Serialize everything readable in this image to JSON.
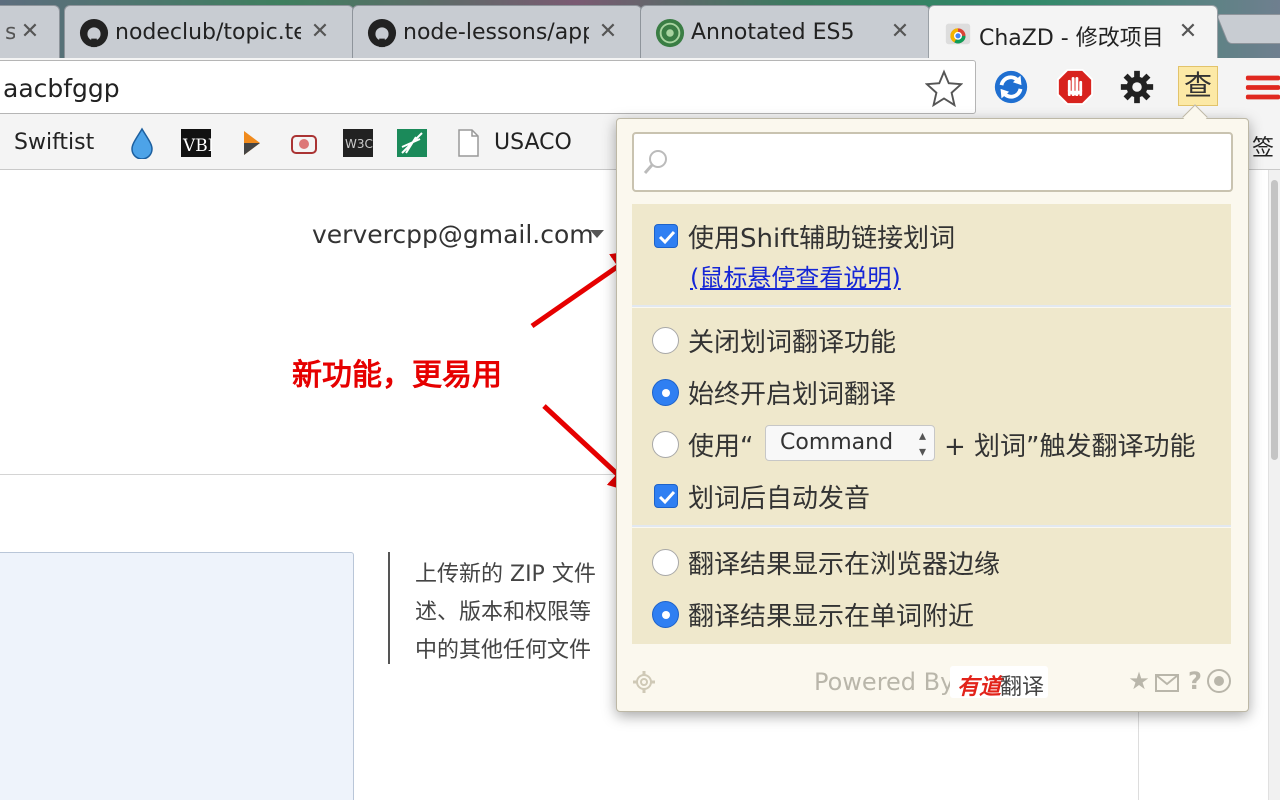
{
  "tabs": [
    {
      "title": "ss",
      "close": "✕"
    },
    {
      "title": "nodeclub/topic.te",
      "close": "✕"
    },
    {
      "title": "node-lessons/app",
      "close": "✕"
    },
    {
      "title": "Annotated ES5",
      "close": "✕"
    },
    {
      "title": "ChaZD - 修改项目",
      "close": "✕"
    }
  ],
  "toolbar": {
    "url": "aacbfggp",
    "extensions": [
      "sync-icon",
      "adblock-icon",
      "gear-icon",
      "chazd-icon",
      "menu-icon"
    ],
    "chazd_label": "查"
  },
  "bookmarks": {
    "swiftist": "Swiftist",
    "usaco": "USACO",
    "overflow": "签"
  },
  "page": {
    "account": "ververcpp@gmail.com",
    "desc_lines": [
      "上传新的 ZIP 文件",
      "述、版本和权限等",
      "中的其他任何文件"
    ]
  },
  "annotation": {
    "text": "新功能，更易用"
  },
  "popup": {
    "search": {
      "value": "",
      "placeholder": ""
    },
    "shift_option": {
      "label": "使用Shift辅助链接划词",
      "checked": true
    },
    "help_link": "(鼠标悬停查看说明)",
    "modes": [
      {
        "label": "关闭划词翻译功能",
        "selected": false
      },
      {
        "label": "始终开启划词翻译",
        "selected": true
      },
      {
        "label_prefix": "使用“",
        "label_suffix": "+ 划词”触发翻译功能",
        "selected": false
      }
    ],
    "modifier_select": {
      "value": "Command"
    },
    "auto_speak": {
      "label": "划词后自动发音",
      "checked": true
    },
    "display": [
      {
        "label": "翻译结果显示在浏览器边缘",
        "selected": false
      },
      {
        "label": "翻译结果显示在单词附近",
        "selected": true
      }
    ],
    "footer": {
      "powered_by": "Powered By",
      "brand": "有道",
      "brand_word": "翻译",
      "icons": [
        "star-icon",
        "mail-icon",
        "help-icon",
        "github-icon"
      ]
    }
  },
  "colors": {
    "accent": "#2f7ff2",
    "section_bg": "#efe8cc",
    "annotation": "#e60000",
    "link": "#1526d6"
  }
}
